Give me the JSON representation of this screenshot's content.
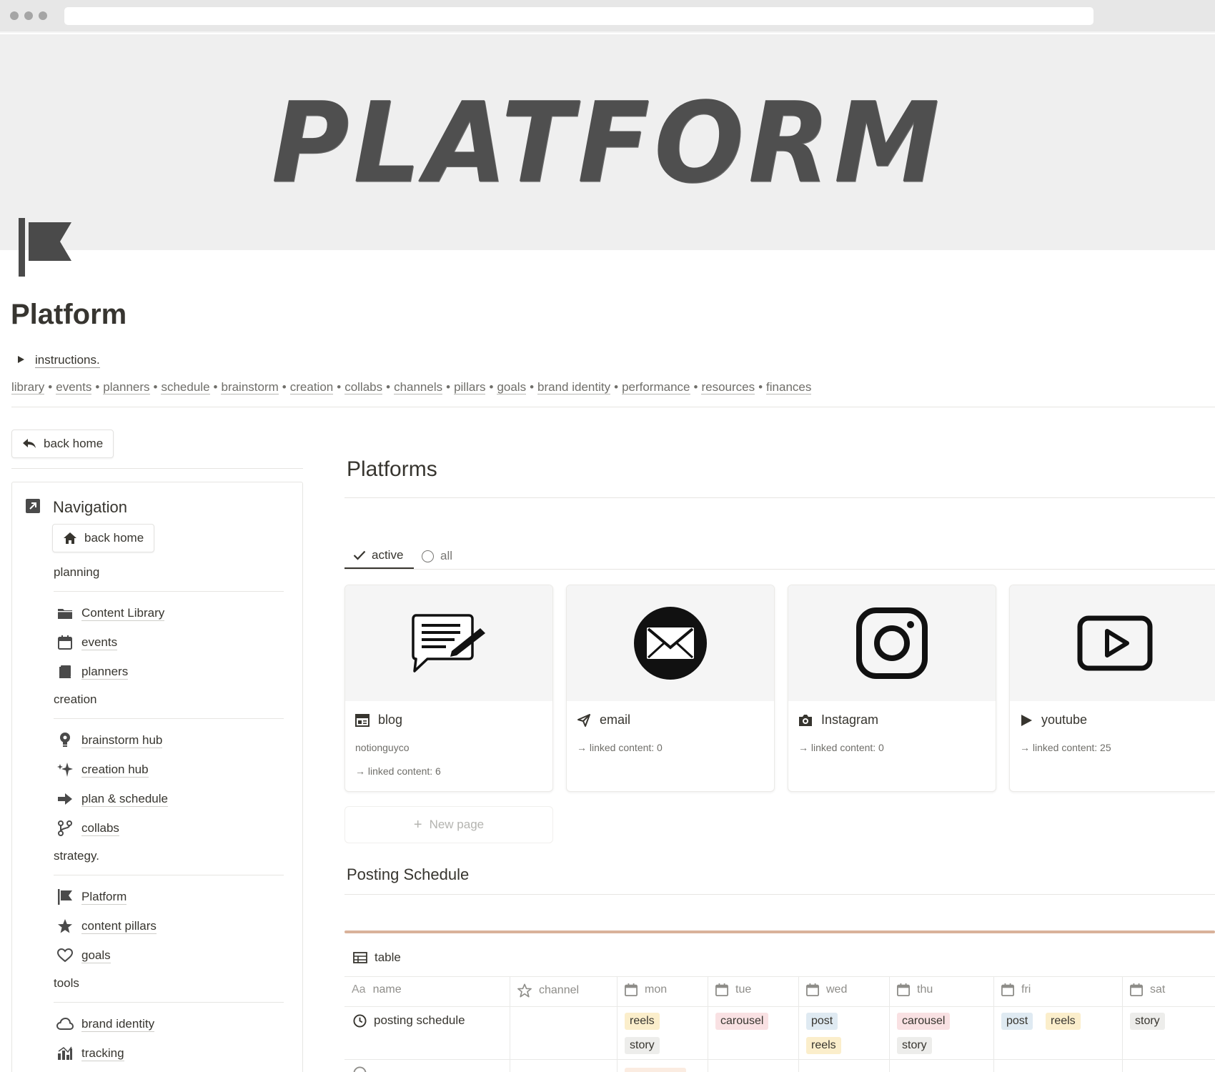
{
  "cover": {
    "title": "PLATFORM"
  },
  "page": {
    "icon": "flag-icon",
    "title": "Platform",
    "toggle_label": "instructions."
  },
  "breadcrumb": [
    "library",
    "events",
    "planners",
    "schedule",
    "brainstorm",
    "creation",
    "collabs",
    "channels",
    "pillars",
    "goals",
    "brand identity",
    "performance",
    "resources",
    "finances"
  ],
  "left": {
    "back_home_button": "back home",
    "nav_heading": "Navigation",
    "nav_back_home": "back home",
    "sections": {
      "planning": "planning",
      "creation": "creation",
      "strategy": "strategy.",
      "tools": "tools"
    },
    "planning_items": [
      {
        "label": "Content Library",
        "icon": "folder-icon"
      },
      {
        "label": "events",
        "icon": "calendar-icon"
      },
      {
        "label": "planners",
        "icon": "book-icon"
      }
    ],
    "creation_items": [
      {
        "label": "brainstorm hub",
        "icon": "lightbulb-icon"
      },
      {
        "label": "creation hub",
        "icon": "sparkles-icon"
      },
      {
        "label": "plan & schedule",
        "icon": "arrow-right-icon"
      },
      {
        "label": "collabs",
        "icon": "branch-icon"
      }
    ],
    "strategy_items": [
      {
        "label": "Platform",
        "icon": "flag-icon"
      },
      {
        "label": "content pillars",
        "icon": "star-icon"
      },
      {
        "label": "goals",
        "icon": "heart-icon"
      }
    ],
    "tools_items": [
      {
        "label": "brand identity",
        "icon": "cloud-icon"
      },
      {
        "label": "tracking",
        "icon": "bar-chart-icon"
      }
    ]
  },
  "main": {
    "heading": "Platforms",
    "tabs": {
      "active": "active",
      "all": "all"
    },
    "cards": [
      {
        "title": "blog",
        "icon": "blog-icon",
        "cover_icon": "chat-pencil-icon",
        "subtitle": "notionguyco",
        "linked": "→ linked content: 6"
      },
      {
        "title": "email",
        "icon": "send-icon",
        "cover_icon": "envelope-icon",
        "subtitle": "",
        "linked": "→ linked content: 0"
      },
      {
        "title": "Instagram",
        "icon": "camera-icon",
        "cover_icon": "instagram-icon",
        "subtitle": "",
        "linked": "→ linked content: 0"
      },
      {
        "title": "youtube",
        "icon": "play-icon",
        "cover_icon": "youtube-icon",
        "subtitle": "",
        "linked": "→ linked content: 25"
      }
    ],
    "new_page": "New page",
    "posting_heading": "Posting Schedule",
    "view_tab": "table",
    "table": {
      "columns": [
        {
          "label": "name",
          "icon": "text-icon",
          "prefix": "Aa"
        },
        {
          "label": "channel",
          "icon": "star-icon"
        },
        {
          "label": "mon",
          "icon": "calendar-icon"
        },
        {
          "label": "tue",
          "icon": "calendar-icon"
        },
        {
          "label": "wed",
          "icon": "calendar-icon"
        },
        {
          "label": "thu",
          "icon": "calendar-icon"
        },
        {
          "label": "fri",
          "icon": "calendar-icon"
        },
        {
          "label": "sat",
          "icon": "calendar-icon"
        }
      ],
      "rows": [
        {
          "name": "posting schedule",
          "channel": "",
          "mon": [
            "reels",
            "story"
          ],
          "tue": [
            "carousel"
          ],
          "wed": [
            "post",
            "reels"
          ],
          "thu": [
            "carousel",
            "story"
          ],
          "fri": [
            "post",
            "reels"
          ],
          "sat": [
            "story"
          ]
        }
      ]
    }
  },
  "colors": {
    "text": "#37352f",
    "muted": "#787774",
    "accent_rule": "#d9b29a",
    "tag_yellow": "#fbeecb",
    "tag_gray": "#ededeb",
    "tag_pink": "#f9e1e3",
    "tag_blue": "#dfeaf2"
  }
}
